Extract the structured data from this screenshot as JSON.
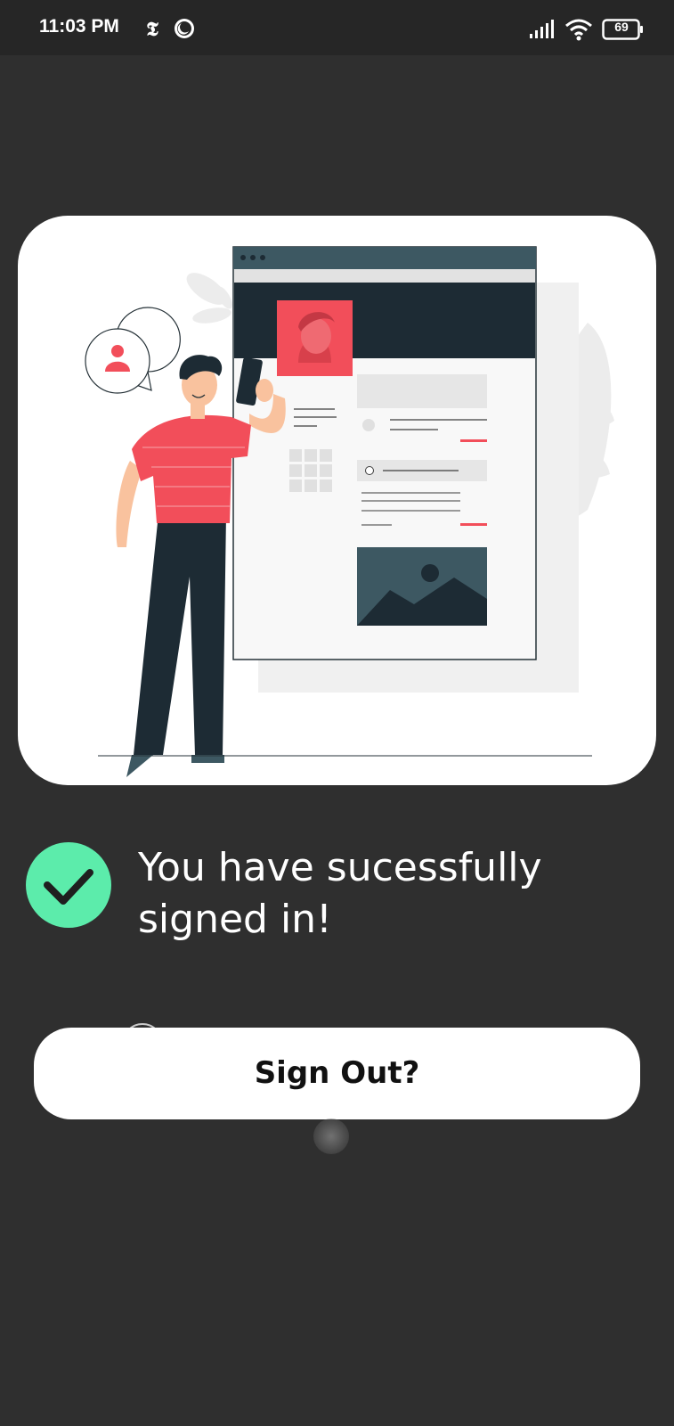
{
  "status_bar": {
    "time": "11:03 PM",
    "battery_level": "69",
    "icons": [
      "nytimes-icon",
      "moon-icon",
      "signal-icon",
      "wifi-icon",
      "battery-icon"
    ]
  },
  "illustration": {
    "description_icon": "user-signin-illustration"
  },
  "success": {
    "icon": "check-circle-icon",
    "message": "You have sucessfully\nsigned in!"
  },
  "sign_out_button": {
    "label": "Sign Out?"
  },
  "colors": {
    "background": "#2f2f2f",
    "status_bar": "#262626",
    "card": "#ffffff",
    "accent_red": "#f24e5a",
    "success_green": "#5cecab",
    "dark_navy": "#1d2b34"
  }
}
